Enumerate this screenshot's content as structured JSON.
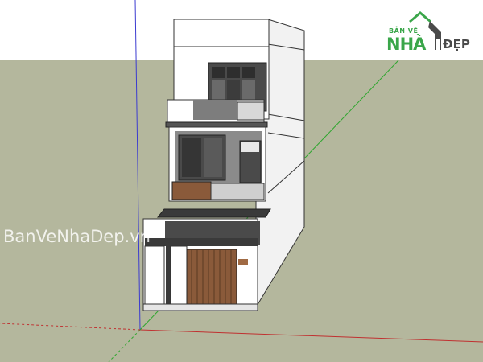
{
  "scene": {
    "description_colors": {
      "sky": "#ffffff",
      "ground": "#b4b79d",
      "wall": "#ffffff",
      "wall_side": "#f0f0f0",
      "glass": "#4a4a4a",
      "wood": "#8a5a3a",
      "concrete": "#7d7d7d",
      "axis_red": "#c03030",
      "axis_green": "#2fa62f",
      "axis_blue": "#3b3bd0"
    }
  },
  "logo": {
    "top_text": "BẢN VẼ",
    "main_text": "NHÀ",
    "suffix_text": "ĐẸP",
    "green": "#3aa64a",
    "gray": "#4a4a4a"
  },
  "watermark": {
    "text": "BanVeNhaDep.vn"
  }
}
